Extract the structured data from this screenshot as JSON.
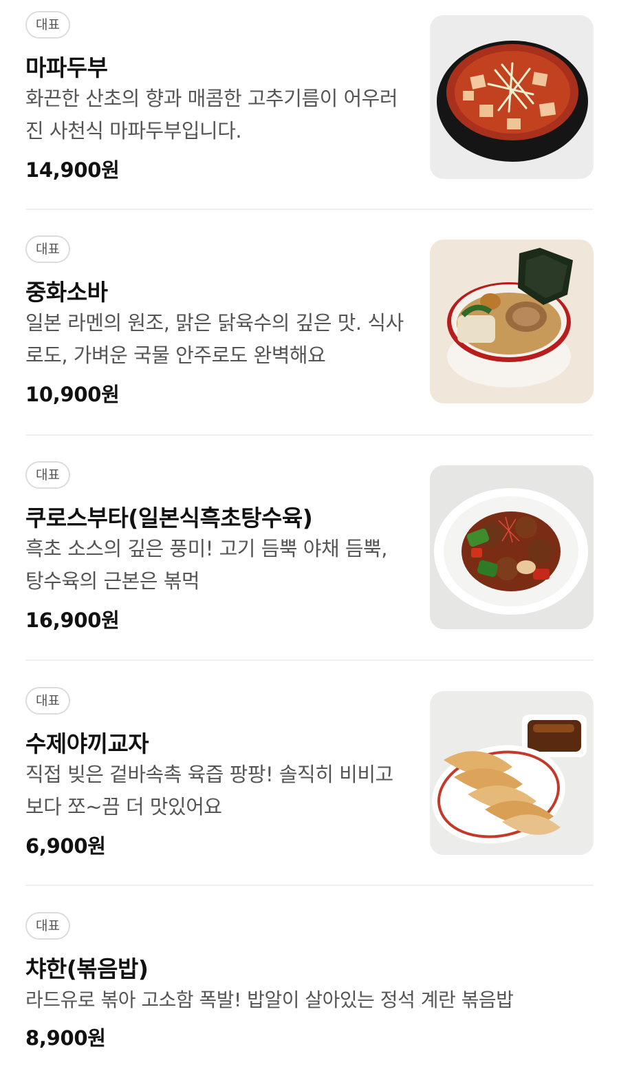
{
  "items": [
    {
      "badge": "대표",
      "name": "마파두부",
      "desc": "화끈한 산초의 향과 매콤한 고추기름이 어우러진 사천식 마파두부입니다.",
      "price": "14,900원",
      "photo_icon": "mapo-tofu-photo"
    },
    {
      "badge": "대표",
      "name": "중화소바",
      "desc": "일본 라멘의 원조, 맑은 닭육수의 깊은 맛. 식사로도, 가벼운 국물 안주로도 완벽해요",
      "price": "10,900원",
      "photo_icon": "ramen-photo"
    },
    {
      "badge": "대표",
      "name": "쿠로스부타(일본식흑초탕수육)",
      "desc": "흑초 소스의 깊은 풍미! 고기 듬뿍 야채 듬뿍, 탕수육의 근본은 볶먹",
      "price": "16,900원",
      "photo_icon": "sweet-sour-pork-photo"
    },
    {
      "badge": "대표",
      "name": "수제야끼교자",
      "desc": "직접 빚은 겉바속촉 육즙 팡팡! 솔직히 비비고보다 쪼~끔 더 맛있어요",
      "price": "6,900원",
      "photo_icon": "gyoza-photo"
    },
    {
      "badge": "대표",
      "name": "챠한(볶음밥)",
      "desc": "라드유로 볶아 고소함 폭발! 밥알이 살아있는 정석 계란 볶음밥",
      "price": "8,900원"
    }
  ]
}
